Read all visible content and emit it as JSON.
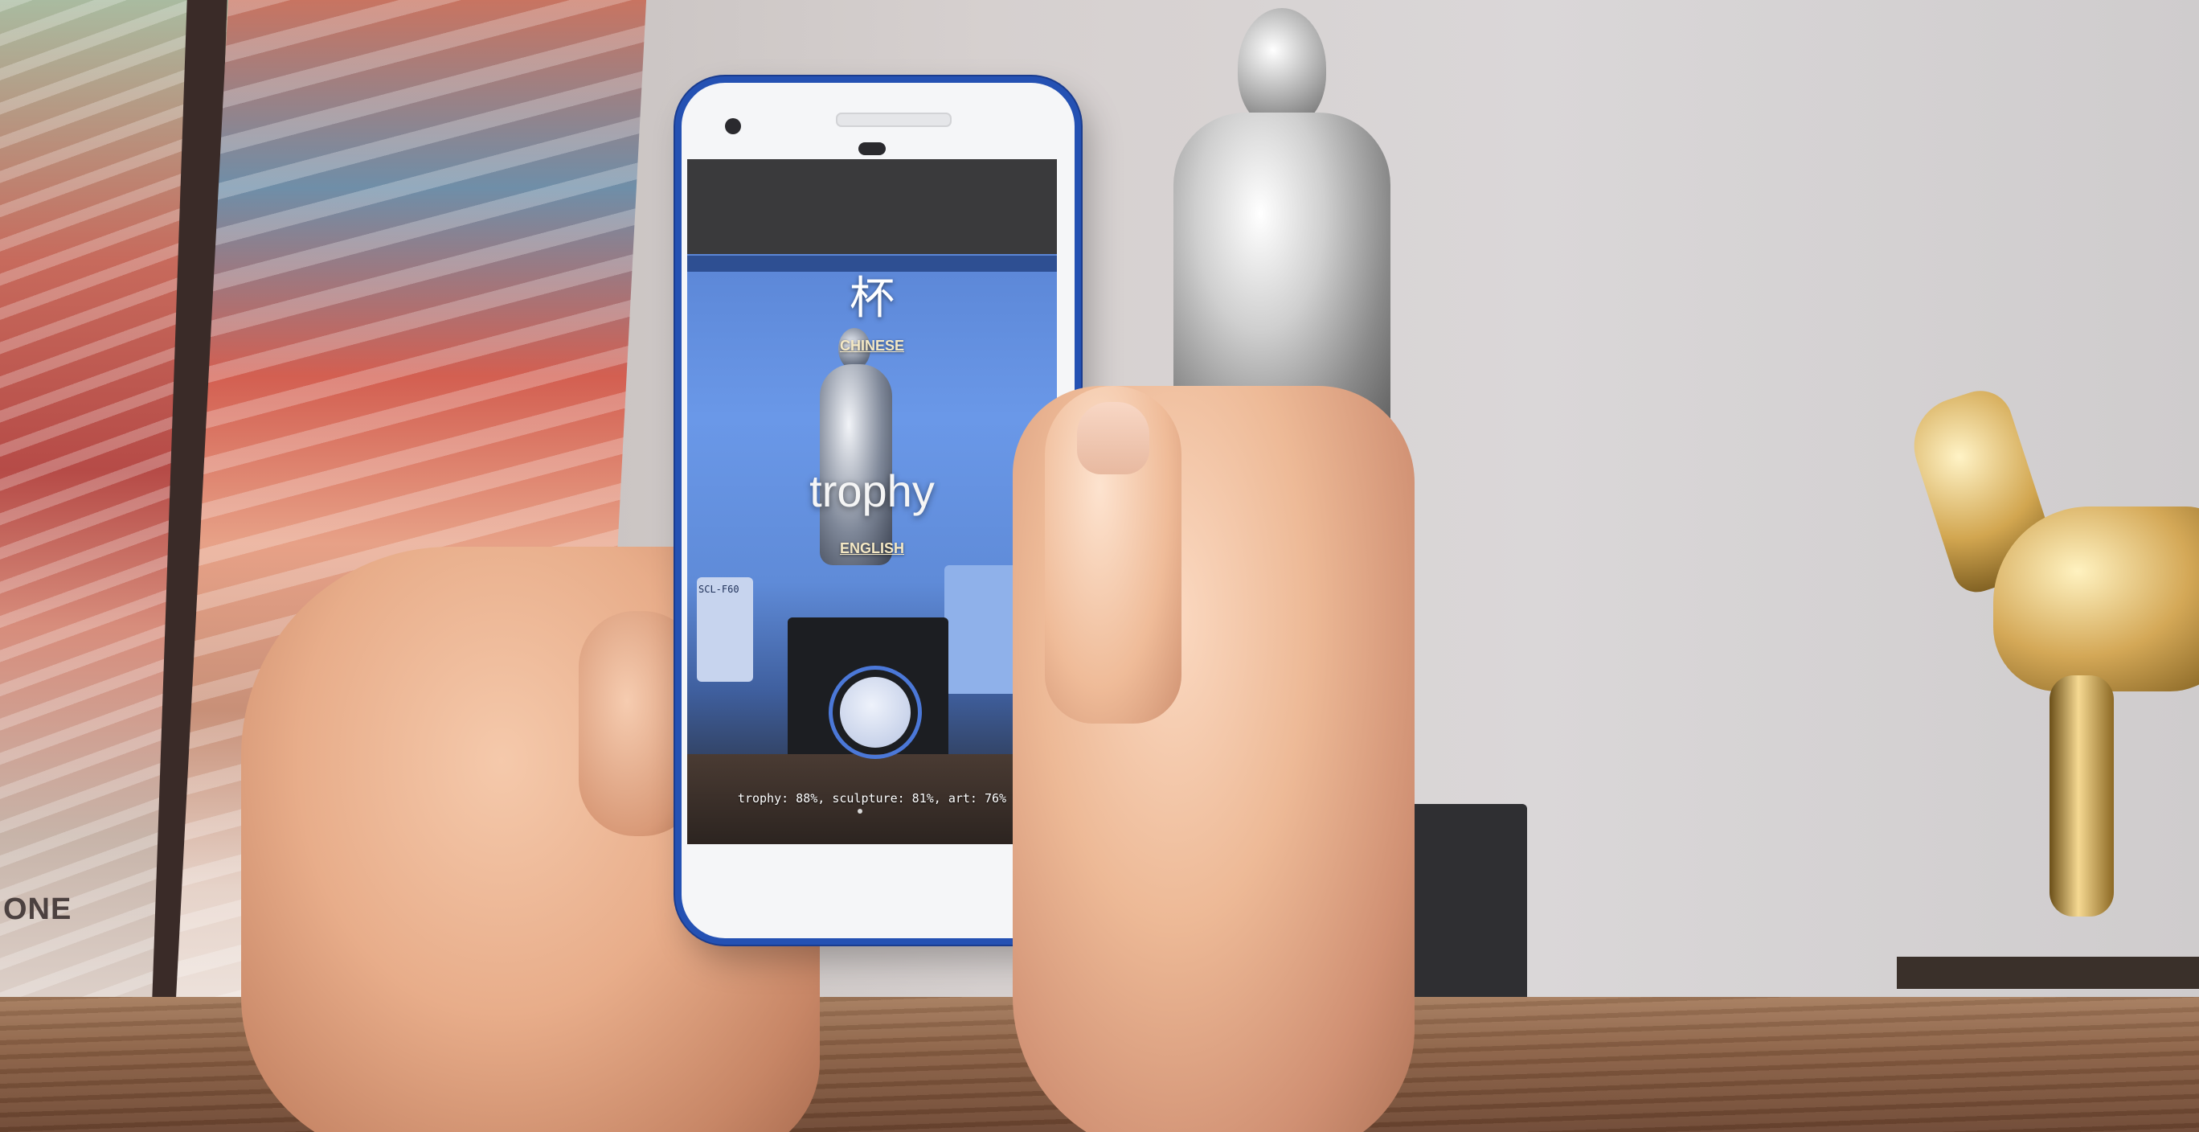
{
  "scene": {
    "box_text": "ONE"
  },
  "phone_app": {
    "translated_word": "杯",
    "translated_language": "CHINESE",
    "detected_word": "trophy",
    "detected_language": "ENGLISH",
    "outlet_label": "SCL-F60",
    "predictions": "trophy: 88%, sculpture: 81%, art: 76%"
  }
}
